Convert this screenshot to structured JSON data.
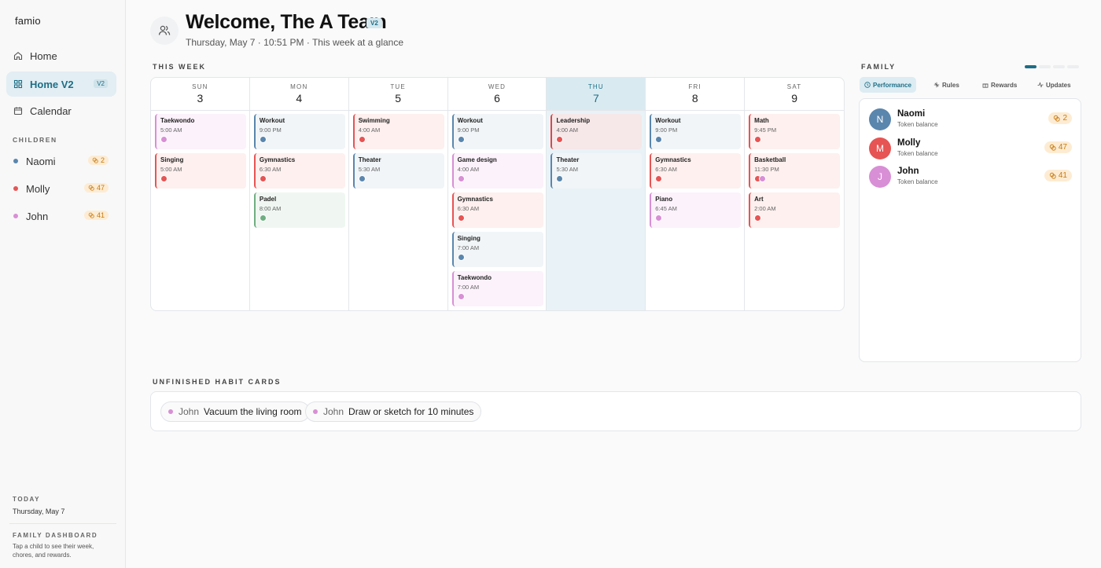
{
  "app": {
    "logo": "famio"
  },
  "sidebar": {
    "nav": [
      {
        "label": "Home",
        "icon": "home-icon"
      },
      {
        "label": "Home V2",
        "icon": "grid-icon",
        "badge": "V2",
        "active": true
      },
      {
        "label": "Calendar",
        "icon": "calendar-icon"
      }
    ],
    "children_label": "CHILDREN",
    "children": [
      {
        "name": "Naomi",
        "tokens": "2",
        "color": "#5a86ad"
      },
      {
        "name": "Molly",
        "tokens": "47",
        "color": "#e65454"
      },
      {
        "name": "John",
        "tokens": "41",
        "color": "#d88fd5"
      }
    ],
    "today_label": "TODAY",
    "today_value": "Thursday, May 7",
    "dashboard_label": "FAMILY DASHBOARD",
    "dashboard_desc": "Tap a child to see their week, chores, and rewards."
  },
  "header": {
    "title": "Welcome, The A Team",
    "badge": "V2",
    "subtitle": "Thursday, May 7 · 10:51 PM · This week at a glance",
    "icon": "users-icon"
  },
  "week": {
    "label": "THIS WEEK",
    "days": [
      {
        "name": "SUN",
        "date": "3",
        "events": [
          {
            "title": "Taekwondo",
            "time": "5:00 AM",
            "child": "john",
            "initials": [
              "J"
            ]
          },
          {
            "title": "Singing",
            "time": "5:00 AM",
            "child": "molly",
            "initials": [
              "M"
            ]
          }
        ]
      },
      {
        "name": "MON",
        "date": "4",
        "events": [
          {
            "title": "Workout",
            "time": "9:00 PM",
            "child": "naomi",
            "initials": [
              "E"
            ]
          },
          {
            "title": "Gymnastics",
            "time": "6:30 AM",
            "child": "molly",
            "initials": [
              "M"
            ]
          },
          {
            "title": "Padel",
            "time": "8:00 AM",
            "child": "green",
            "initials": [
              "A"
            ]
          }
        ]
      },
      {
        "name": "TUE",
        "date": "5",
        "events": [
          {
            "title": "Swimming",
            "time": "4:00 AM",
            "child": "molly",
            "initials": [
              "M"
            ]
          },
          {
            "title": "Theater",
            "time": "5:30 AM",
            "child": "naomi",
            "initials": [
              "N"
            ]
          }
        ]
      },
      {
        "name": "WED",
        "date": "6",
        "events": [
          {
            "title": "Workout",
            "time": "9:00 PM",
            "child": "naomi",
            "initials": [
              "E"
            ]
          },
          {
            "title": "Game design",
            "time": "4:00 AM",
            "child": "john",
            "initials": [
              "J"
            ]
          },
          {
            "title": "Gymnastics",
            "time": "6:30 AM",
            "child": "molly",
            "initials": [
              "M"
            ]
          },
          {
            "title": "Singing",
            "time": "7:00 AM",
            "child": "naomi",
            "initials": [
              "N"
            ]
          },
          {
            "title": "Taekwondo",
            "time": "7:00 AM",
            "child": "john",
            "initials": [
              "J"
            ]
          }
        ]
      },
      {
        "name": "THU",
        "date": "7",
        "today": true,
        "events": [
          {
            "title": "Leadership",
            "time": "4:00 AM",
            "child": "dark",
            "initials": [
              "M"
            ]
          },
          {
            "title": "Theater",
            "time": "5:30 AM",
            "child": "naomi",
            "initials": [
              "N"
            ]
          }
        ]
      },
      {
        "name": "FRI",
        "date": "8",
        "events": [
          {
            "title": "Workout",
            "time": "9:00 PM",
            "child": "naomi",
            "initials": [
              "E"
            ]
          },
          {
            "title": "Gymnastics",
            "time": "6:30 AM",
            "child": "molly",
            "initials": [
              "M"
            ]
          },
          {
            "title": "Piano",
            "time": "6:45 AM",
            "child": "john",
            "initials": [
              "J"
            ]
          }
        ]
      },
      {
        "name": "SAT",
        "date": "9",
        "events": [
          {
            "title": "Math",
            "time": "9:45 PM",
            "child": "molly",
            "initials": [
              "M"
            ]
          },
          {
            "title": "Basketball",
            "time": "11:30 PM",
            "child": "molly",
            "initials": [
              "M",
              "J"
            ]
          },
          {
            "title": "Art",
            "time": "2:00 AM",
            "child": "molly",
            "initials": [
              "M"
            ]
          }
        ]
      }
    ]
  },
  "family": {
    "label": "FAMILY",
    "tabs": [
      {
        "label": "Performance",
        "icon": "clock-icon",
        "active": true
      },
      {
        "label": "Rules",
        "icon": "sparkle-icon"
      },
      {
        "label": "Rewards",
        "icon": "gift-icon"
      },
      {
        "label": "Updates",
        "icon": "activity-icon"
      }
    ],
    "members": [
      {
        "initial": "N",
        "name": "Naomi",
        "sub": "Token balance",
        "tokens": "2",
        "color": "#5a86ad"
      },
      {
        "initial": "M",
        "name": "Molly",
        "sub": "Token balance",
        "tokens": "47",
        "color": "#e65454"
      },
      {
        "initial": "J",
        "name": "John",
        "sub": "Token balance",
        "tokens": "41",
        "color": "#d88fd5"
      }
    ]
  },
  "habits": {
    "label": "UNFINISHED HABIT CARDS",
    "items": [
      {
        "who": "John",
        "task": "Vacuum the living room"
      },
      {
        "who": "John",
        "task": "Draw or sketch for 10 minutes"
      }
    ]
  },
  "colors": {
    "accent": "#1d6e86",
    "naomi": "#5a86ad",
    "molly": "#e65454",
    "john": "#d88fd5",
    "token": "#c77a10"
  }
}
